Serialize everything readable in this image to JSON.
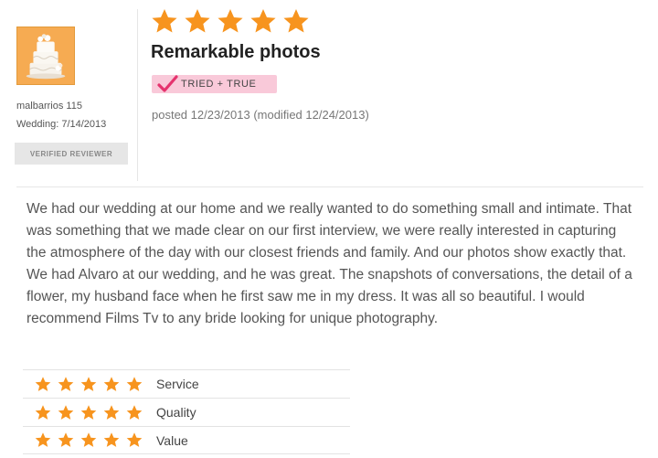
{
  "reviewer": {
    "username": "malbarrios 115",
    "wedding_date": "Wedding: 7/14/2013",
    "verified_label": "VERIFIED REVIEWER"
  },
  "review": {
    "overall_rating": 5,
    "title": "Remarkable photos",
    "badge_label": "TRIED + TRUE",
    "posted": "posted 12/23/2013 (modified 12/24/2013)",
    "paragraph_1": "We had our wedding at our home and we really wanted to do something small and intimate. That was something that we made clear on our first interview, we were really interested in capturing the atmosphere of the day with our closest friends and family. And our photos show exactly that.",
    "paragraph_2": "We had Alvaro at our wedding, and he was great. The snapshots of conversations, the detail of a flower, my husband face when he first saw me in my dress. It was all so beautiful. I would recommend Films Tv to any bride looking for unique photography."
  },
  "ratings": [
    {
      "label": "Service",
      "stars": 5
    },
    {
      "label": "Quality",
      "stars": 5
    },
    {
      "label": "Value",
      "stars": 5
    }
  ],
  "colors": {
    "star": "#f7941e",
    "badge_bg": "#f9c9d9",
    "badge_check": "#e5336e"
  }
}
